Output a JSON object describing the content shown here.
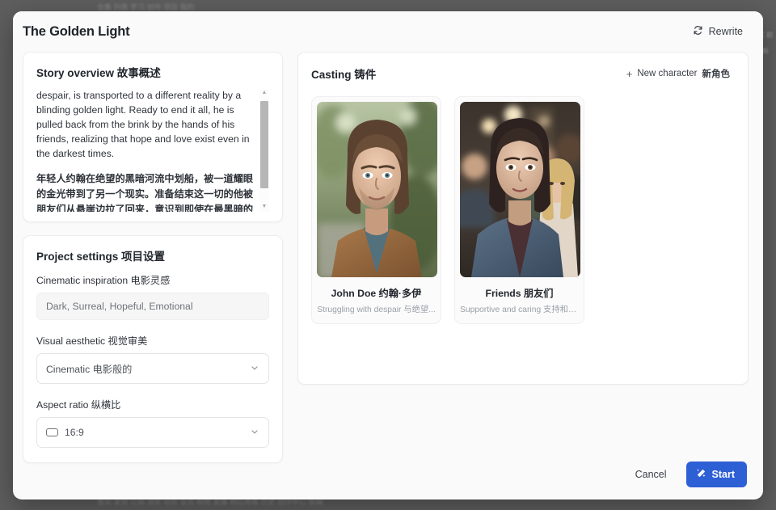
{
  "modal": {
    "title": "The Golden Light",
    "rewrite_label": "Rewrite",
    "rewrite_icon": "refresh-loop-icon"
  },
  "story": {
    "title": "Story overview 故事概述",
    "paragraph_en": "despair, is transported to a different reality by a blinding golden light. Ready to end it all, he is pulled back from the brink by the hands of his friends, realizing that hope and love exist even in the darkest times.",
    "paragraph_cn": "年轻人约翰在绝望的黑暗河流中划船，被一道耀眼的金光带到了另一个现实。准备结束这一切的他被朋友们从悬崖边拉了回来，意识到即使在最黑暗的时刻也存在希望和爱。",
    "scroll_up_icon": "▲",
    "scroll_down_icon": "▼"
  },
  "settings": {
    "title": "Project settings 项目设置",
    "inspiration": {
      "label": "Cinematic inspiration 电影灵感",
      "value": "",
      "placeholder": "Dark, Surreal, Hopeful, Emotional"
    },
    "aesthetic": {
      "label": "Visual aesthetic 视觉审美",
      "value": "Cinematic  电影般的",
      "chevron_icon": "chevron-down-icon"
    },
    "aspect_ratio": {
      "label": "Aspect ratio 纵横比",
      "value": "16:9",
      "ratio_icon": "rectangle-16-9-icon",
      "chevron_icon": "chevron-down-icon"
    }
  },
  "casting": {
    "title": "Casting 铸件",
    "new_character_label": "New character",
    "new_character_label_cn": "新角色",
    "plus_icon": "plus-icon",
    "characters": [
      {
        "name": "John Doe 约翰·多伊",
        "description": "Struggling with despair 与绝望...",
        "photo": "portrait-man-long-hair-tan-jacket"
      },
      {
        "name": "Friends 朋友们",
        "description": "Supportive and caring 支持和关怀",
        "photo": "group-woman-denim-jacket-indoor-lights"
      }
    ]
  },
  "footer": {
    "cancel_label": "Cancel",
    "start_label": "Start",
    "start_icon": "magic-wand-icon",
    "start_color": "#2d5fd5"
  },
  "backdrop": {
    "top_text": "合集 列表 学习 创作 项目 我的",
    "bottom_text": "首页 发现 订阅 消息 动态 会员 购物 直播 稍后再看 历史 创作中心 投稿",
    "right_text": "买 剧 新"
  }
}
